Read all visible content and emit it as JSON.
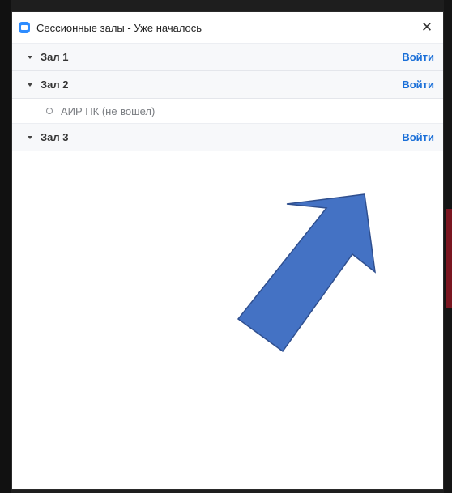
{
  "window": {
    "title": "Сессионные залы - Уже началось",
    "close_icon": "close-icon"
  },
  "rooms": [
    {
      "name": "Зал 1",
      "join_label": "Войти",
      "participants": []
    },
    {
      "name": "Зал 2",
      "join_label": "Войти",
      "participants": [
        {
          "name": "АИР ПК (не вошел)"
        }
      ]
    },
    {
      "name": "Зал 3",
      "join_label": "Войти",
      "participants": []
    }
  ],
  "colors": {
    "accent": "#1a6fd8",
    "app_icon": "#2d8cff",
    "annotation_arrow": "#4472c4"
  }
}
